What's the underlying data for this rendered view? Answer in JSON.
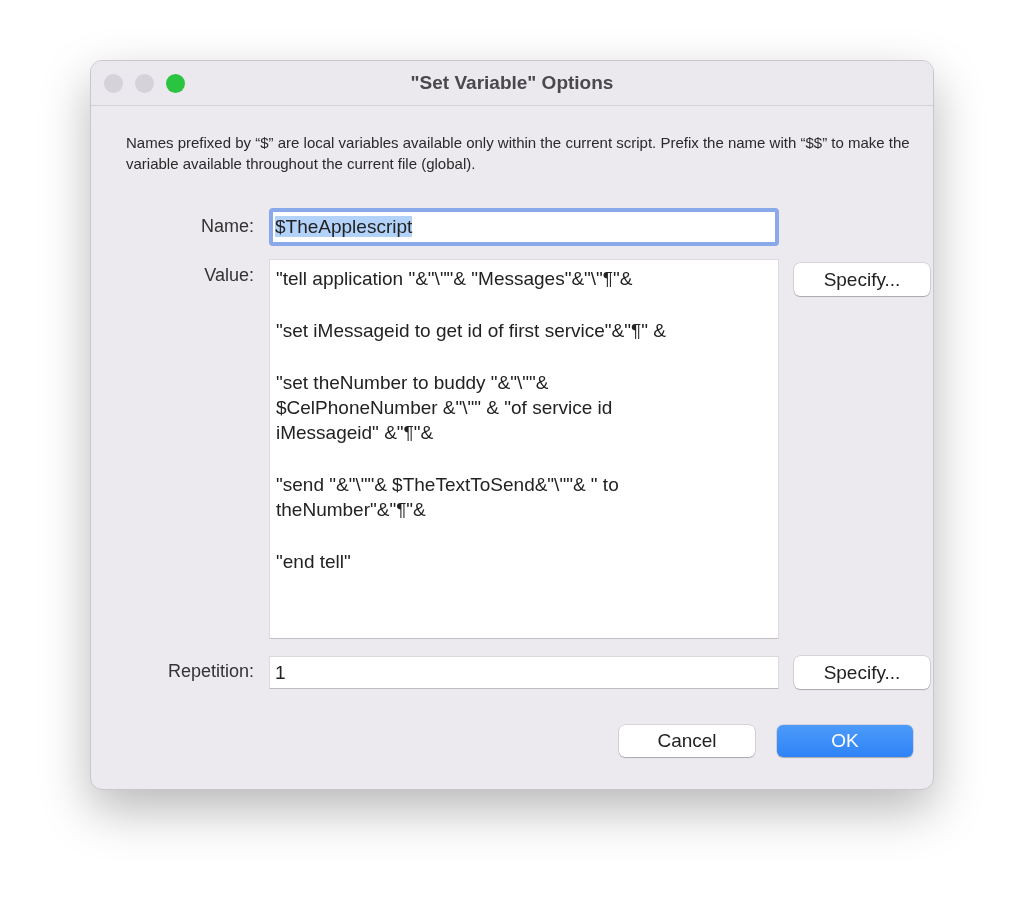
{
  "window": {
    "title": "\"Set Variable\" Options",
    "controls": [
      {
        "color": "#d5d2d9"
      },
      {
        "color": "#d5d2d9"
      },
      {
        "color": "#2bc440"
      }
    ]
  },
  "description": "Names prefixed by “$” are local variables available only within the current script. Prefix the name with “$$” to make the variable available throughout the current file (global).",
  "name_field": {
    "label": "Name:",
    "value": "$TheApplescript",
    "focused": true,
    "text_selected": true
  },
  "value_field": {
    "label": "Value:",
    "button": "Specify...",
    "paragraphs": [
      {
        "lines": [
          "\"tell application \"&\"\\\"\"& \"Messages\"&\"\\\"¶\"&"
        ]
      },
      {
        "lines": [
          "\"set iMessageid to get id of first service\"&\"¶\" &"
        ]
      },
      {
        "lines": [
          "\"set theNumber to buddy \"&\"\\\"\"&",
          "$CelPhoneNumber &\"\\\"\" & \"of service id",
          "iMessageid\" &\"¶\"&"
        ]
      },
      {
        "lines": [
          "\"send \"&\"\\\"\"& $TheTextToSend&\"\\\"\"& \" to",
          "theNumber\"&\"¶\"&"
        ]
      },
      {
        "lines": [
          "\"end tell\""
        ]
      }
    ]
  },
  "repetition_field": {
    "label": "Repetition:",
    "value": "1",
    "button": "Specify..."
  },
  "buttons": [
    {
      "label": "Cancel",
      "kind": "secondary"
    },
    {
      "label": "OK",
      "kind": "primary"
    }
  ]
}
